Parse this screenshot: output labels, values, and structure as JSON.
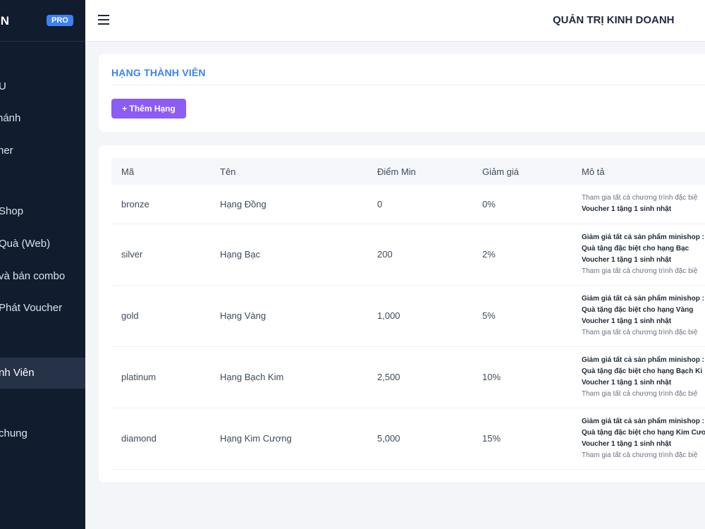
{
  "brand": {
    "name": "IN",
    "badge": "PRO"
  },
  "sidebar": {
    "items": [
      {
        "label": "U",
        "active": false
      },
      {
        "label": "hánh",
        "active": false
      },
      {
        "label": "ner",
        "active": false
      },
      {
        "label": "Shop",
        "active": false
      },
      {
        "label": "Quà (Web)",
        "active": false
      },
      {
        "label": "và bán combo",
        "active": false
      },
      {
        "label": "Phát Voucher",
        "active": false
      },
      {
        "label": "nh Viên",
        "active": true
      },
      {
        "label": "chung",
        "active": false
      }
    ]
  },
  "topbar": {
    "title": "QUẢN TRỊ KINH DOANH"
  },
  "section": {
    "title": "HẠNG THÀNH VIÊN",
    "add_button": "+ Thêm Hạng"
  },
  "table": {
    "headers": [
      "Mã",
      "Tên",
      "Điểm Min",
      "Giảm giá",
      "Mô tả"
    ],
    "rows": [
      {
        "code": "bronze",
        "name": "Hạng Đồng",
        "min": "0",
        "discount": "0%",
        "desc": [
          {
            "t": "Tham gia tất cả chương trình đặc biệ",
            "b": false
          },
          {
            "t": "Voucher 1 tặng 1 sinh nhật",
            "b": true
          }
        ]
      },
      {
        "code": "silver",
        "name": "Hạng Bạc",
        "min": "200",
        "discount": "2%",
        "desc": [
          {
            "t": "Giảm giá tất cả sản phẩm minishop :",
            "b": true
          },
          {
            "t": "Quà tặng đặc biệt cho hạng Bạc",
            "b": true
          },
          {
            "t": "Voucher 1 tặng 1 sinh nhật",
            "b": true
          },
          {
            "t": "Tham gia tất cả chương trình đặc biệ",
            "b": false
          }
        ]
      },
      {
        "code": "gold",
        "name": "Hạng Vàng",
        "min": "1,000",
        "discount": "5%",
        "desc": [
          {
            "t": "Giảm giá tất cả sản phẩm minishop :",
            "b": true
          },
          {
            "t": "Quà tặng đặc biệt cho hạng Vàng",
            "b": true
          },
          {
            "t": "Voucher 1 tặng 1 sinh nhật",
            "b": true
          },
          {
            "t": "Tham gia tất cả chương trình đặc biệ",
            "b": false
          }
        ]
      },
      {
        "code": "platinum",
        "name": "Hạng Bạch Kim",
        "min": "2,500",
        "discount": "10%",
        "desc": [
          {
            "t": "Giảm giá tất cả sản phẩm minishop :",
            "b": true
          },
          {
            "t": "Quà tặng đặc biệt cho hạng Bạch Ki",
            "b": true
          },
          {
            "t": "Voucher 1 tặng 1 sinh nhật",
            "b": true
          },
          {
            "t": "Tham gia tất cả chương trình đặc biệ",
            "b": false
          }
        ]
      },
      {
        "code": "diamond",
        "name": "Hạng Kim Cương",
        "min": "5,000",
        "discount": "15%",
        "desc": [
          {
            "t": "Giảm giá tất cả sản phẩm minishop :",
            "b": true
          },
          {
            "t": "Quà tặng đặc biệt cho hạng Kim Cươ",
            "b": true
          },
          {
            "t": "Voucher 1 tặng 1 sinh nhật",
            "b": true
          },
          {
            "t": "Tham gia tất cả chương trình đặc biệ",
            "b": false
          }
        ]
      }
    ]
  }
}
